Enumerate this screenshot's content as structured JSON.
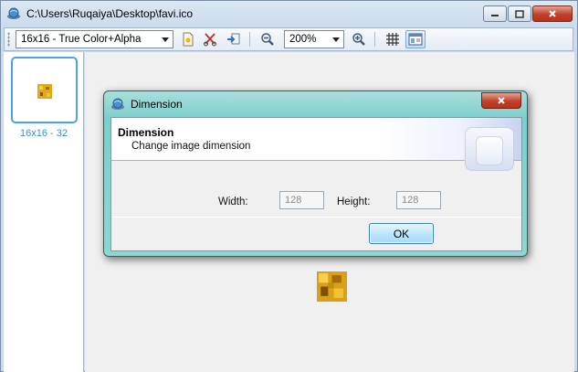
{
  "window": {
    "title": "C:\\Users\\Ruqaiya\\Desktop\\favi.ico"
  },
  "toolbar": {
    "format_select": "16x16 - True Color+Alpha",
    "zoom_select": "200%"
  },
  "left_panel": {
    "thumbnail_label": "16x16 - 32"
  },
  "dialog": {
    "title": "Dimension",
    "header_title": "Dimension",
    "header_subtitle": "Change image dimension",
    "width_label": "Width:",
    "width_value": "128",
    "height_label": "Height:",
    "height_value": "128",
    "ok_label": "OK"
  },
  "colors": {
    "accent_blue": "#4ea1e6",
    "close_red": "#c2402a",
    "dialog_frame": "#7ccfcc"
  }
}
